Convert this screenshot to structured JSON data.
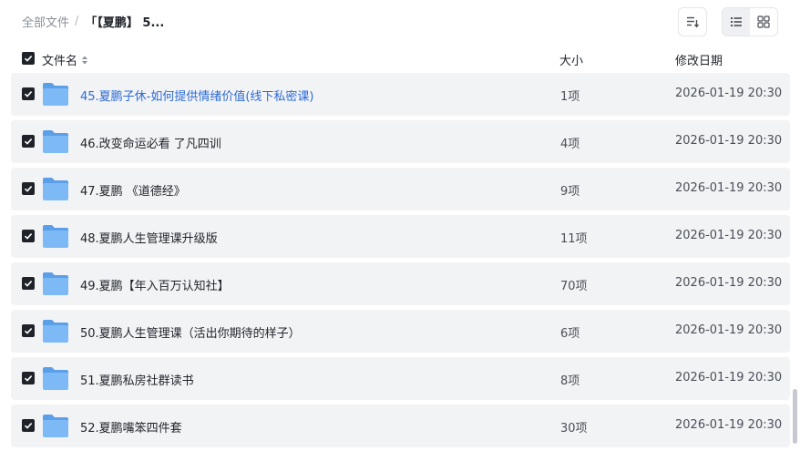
{
  "breadcrumb": {
    "root": "全部文件",
    "separator": "/",
    "current": "「【夏鹏】 5..."
  },
  "toolbar": {
    "sort_icon": "sort-icon",
    "list_view_icon": "list-view-icon",
    "grid_view_icon": "grid-view-icon",
    "active_view": "list"
  },
  "table": {
    "columns": {
      "name": "文件名",
      "size": "大小",
      "date": "修改日期"
    },
    "rows": [
      {
        "name": "45.夏鹏子休-如何提供情绪价值(线下私密课)",
        "size": "1项",
        "date": "2026-01-19 20:30",
        "checked": true,
        "highlighted": true
      },
      {
        "name": "46.改变命运必看 了凡四训",
        "size": "4项",
        "date": "2026-01-19 20:30",
        "checked": true,
        "highlighted": false
      },
      {
        "name": "47.夏鹏 《道德经》",
        "size": "9项",
        "date": "2026-01-19 20:30",
        "checked": true,
        "highlighted": false
      },
      {
        "name": "48.夏鹏人生管理课升级版",
        "size": "11项",
        "date": "2026-01-19 20:30",
        "checked": true,
        "highlighted": false
      },
      {
        "name": "49.夏鹏【年入百万认知社】",
        "size": "70项",
        "date": "2026-01-19 20:30",
        "checked": true,
        "highlighted": false
      },
      {
        "name": "50.夏鹏人生管理课（活出你期待的样子）",
        "size": "6项",
        "date": "2026-01-19 20:30",
        "checked": true,
        "highlighted": false
      },
      {
        "name": "51.夏鹏私房社群读书",
        "size": "8项",
        "date": "2026-01-19 20:30",
        "checked": true,
        "highlighted": false
      },
      {
        "name": "52.夏鹏嘴笨四件套",
        "size": "30项",
        "date": "2026-01-19 20:30",
        "checked": true,
        "highlighted": false
      }
    ]
  },
  "colors": {
    "row_background": "#f2f3f5",
    "link_text": "#2c6bd6",
    "folder_blue": "#6aaef2",
    "checkbox_fill": "#1f2329"
  }
}
